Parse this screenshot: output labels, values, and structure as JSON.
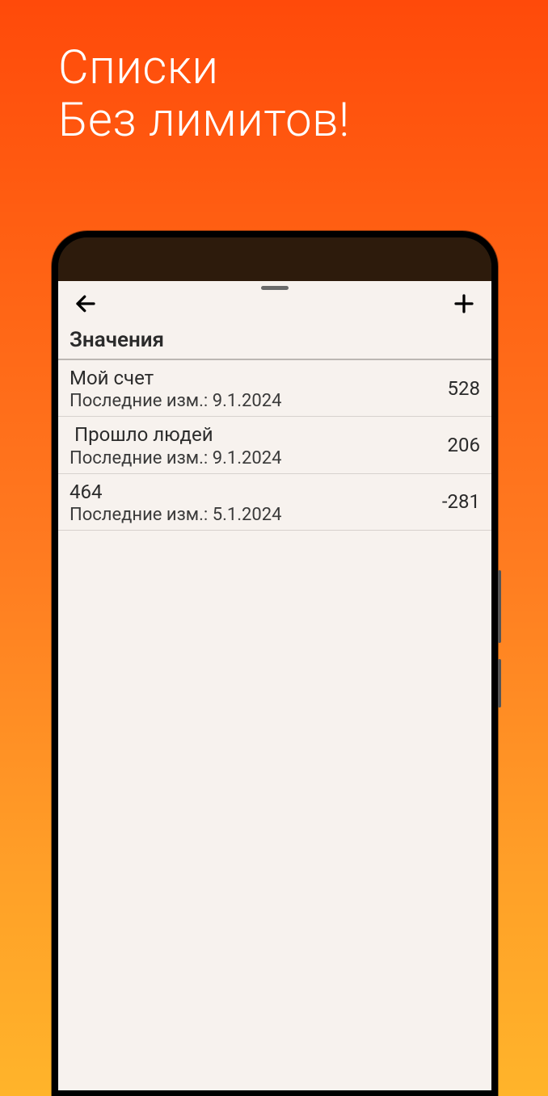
{
  "promo": {
    "line1": "Списки",
    "line2": "Без лимитов!"
  },
  "screen": {
    "section_title": "Значения",
    "sub_prefix": "Последние изм.: ",
    "rows": [
      {
        "title": "Мой счет",
        "date": "9.1.2024",
        "value": "528",
        "indent": false
      },
      {
        "title": "Прошло людей",
        "date": "9.1.2024",
        "value": "206",
        "indent": true
      },
      {
        "title": "464",
        "date": "5.1.2024",
        "value": "-281",
        "indent": false
      }
    ]
  }
}
